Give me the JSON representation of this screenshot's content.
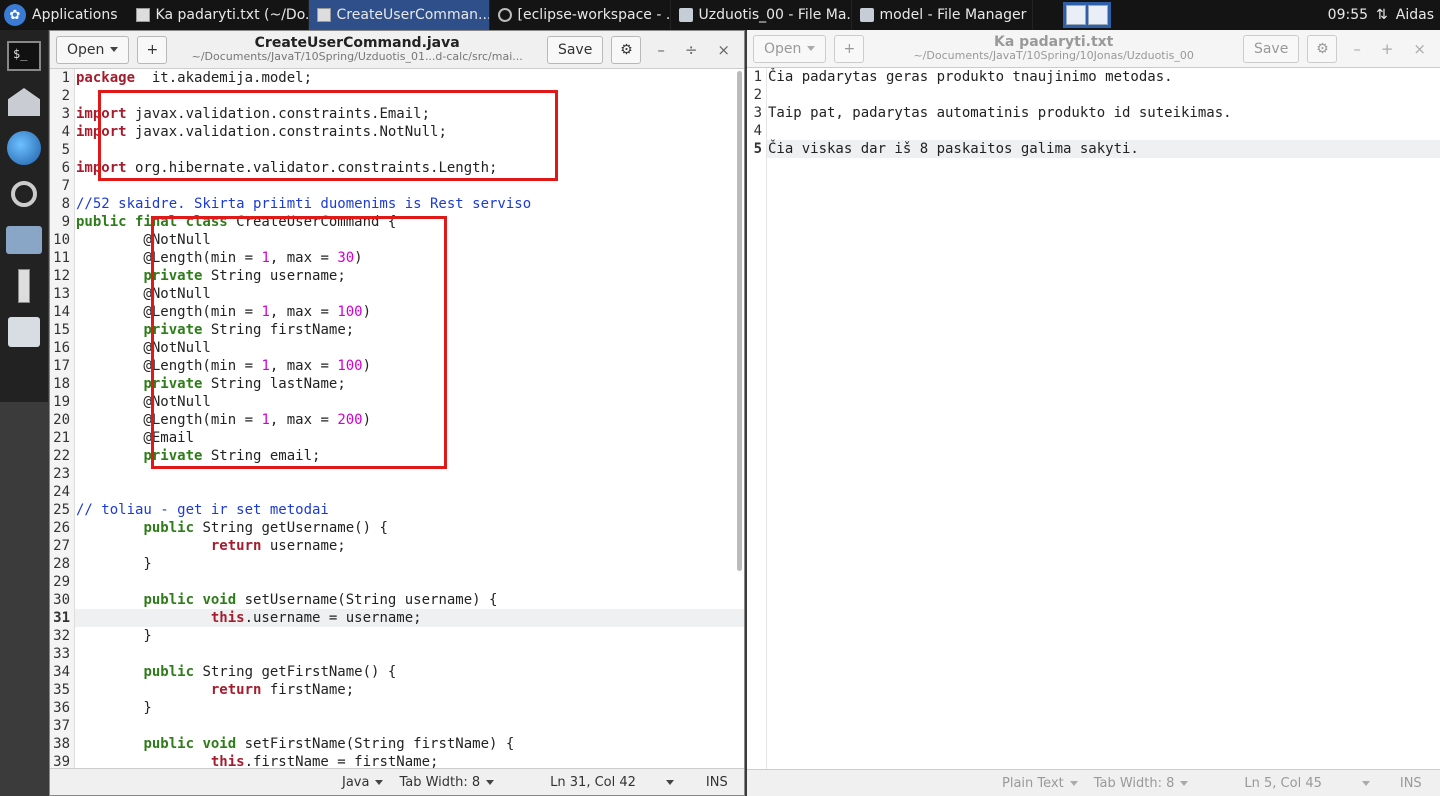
{
  "taskbar": {
    "apps_label": "Applications",
    "tasks": [
      {
        "label": "Ka padaryti.txt (~/Do...",
        "icon": "text-editor-icon"
      },
      {
        "label": "CreateUserComman...",
        "icon": "text-editor-icon"
      },
      {
        "label": "[eclipse-workspace - ...",
        "icon": "eclipse-icon"
      },
      {
        "label": "Uzduotis_00 - File Ma...",
        "icon": "folder-icon"
      },
      {
        "label": "model - File Manager",
        "icon": "folder-icon"
      }
    ],
    "clock": "09:55",
    "user": "Aidas"
  },
  "left": {
    "open_label": "Open",
    "save_label": "Save",
    "title": "CreateUserCommand.java",
    "subtitle": "~/Documents/JavaT/10Spring/Uzduotis_01...d-calc/src/mai...",
    "status": {
      "language": "Java",
      "tab_width": "Tab Width: 8",
      "position": "Ln 31, Col 42",
      "mode": "INS"
    },
    "current_line": 31,
    "lines": [
      [
        [
          "kw",
          "package"
        ],
        [
          "",
          "  it.akademija.model;"
        ]
      ],
      [],
      [
        [
          "kw",
          "import"
        ],
        [
          "",
          " javax.validation.constraints.Email;"
        ]
      ],
      [
        [
          "kw",
          "import"
        ],
        [
          "",
          " javax.validation.constraints.NotNull;"
        ]
      ],
      [],
      [
        [
          "kw",
          "import"
        ],
        [
          "",
          " org.hibernate.validator.constraints.Length;"
        ]
      ],
      [],
      [
        [
          "cmt",
          "//52 skaidre. Skirta priimti duomenims is Rest serviso"
        ]
      ],
      [
        [
          "kw2",
          "public final class"
        ],
        [
          "",
          " CreateUserCommand {"
        ]
      ],
      [
        [
          "",
          "        @NotNull"
        ]
      ],
      [
        [
          "",
          "        @Length(min = "
        ],
        [
          "num",
          "1"
        ],
        [
          "",
          ", max = "
        ],
        [
          "num",
          "30"
        ],
        [
          "",
          ")"
        ]
      ],
      [
        [
          "",
          "        "
        ],
        [
          "kw2",
          "private"
        ],
        [
          "",
          " String username;"
        ]
      ],
      [
        [
          "",
          "        @NotNull"
        ]
      ],
      [
        [
          "",
          "        @Length(min = "
        ],
        [
          "num",
          "1"
        ],
        [
          "",
          ", max = "
        ],
        [
          "num",
          "100"
        ],
        [
          "",
          ")"
        ]
      ],
      [
        [
          "",
          "        "
        ],
        [
          "kw2",
          "private"
        ],
        [
          "",
          " String firstName;"
        ]
      ],
      [
        [
          "",
          "        @NotNull"
        ]
      ],
      [
        [
          "",
          "        @Length(min = "
        ],
        [
          "num",
          "1"
        ],
        [
          "",
          ", max = "
        ],
        [
          "num",
          "100"
        ],
        [
          "",
          ")"
        ]
      ],
      [
        [
          "",
          "        "
        ],
        [
          "kw2",
          "private"
        ],
        [
          "",
          " String lastName;"
        ]
      ],
      [
        [
          "",
          "        @NotNull"
        ]
      ],
      [
        [
          "",
          "        @Length(min = "
        ],
        [
          "num",
          "1"
        ],
        [
          "",
          ", max = "
        ],
        [
          "num",
          "200"
        ],
        [
          "",
          ")"
        ]
      ],
      [
        [
          "",
          "        @Email"
        ]
      ],
      [
        [
          "",
          "        "
        ],
        [
          "kw2",
          "private"
        ],
        [
          "",
          " String email;"
        ]
      ],
      [],
      [],
      [
        [
          "cmt",
          "// toliau - get ir set metodai"
        ]
      ],
      [
        [
          "",
          "        "
        ],
        [
          "kw2",
          "public"
        ],
        [
          "",
          " String getUsername() {"
        ]
      ],
      [
        [
          "",
          "                "
        ],
        [
          "kw",
          "return"
        ],
        [
          "",
          " username;"
        ]
      ],
      [
        [
          "",
          "        }"
        ]
      ],
      [],
      [
        [
          "",
          "        "
        ],
        [
          "kw2",
          "public void"
        ],
        [
          "",
          " setUsername(String username) {"
        ]
      ],
      [
        [
          "",
          "                "
        ],
        [
          "kw",
          "this"
        ],
        [
          "",
          ".username = username;"
        ]
      ],
      [
        [
          "",
          "        }"
        ]
      ],
      [],
      [
        [
          "",
          "        "
        ],
        [
          "kw2",
          "public"
        ],
        [
          "",
          " String getFirstName() {"
        ]
      ],
      [
        [
          "",
          "                "
        ],
        [
          "kw",
          "return"
        ],
        [
          "",
          " firstName;"
        ]
      ],
      [
        [
          "",
          "        }"
        ]
      ],
      [],
      [
        [
          "",
          "        "
        ],
        [
          "kw2",
          "public void"
        ],
        [
          "",
          " setFirstName(String firstName) {"
        ]
      ],
      [
        [
          "",
          "                "
        ],
        [
          "kw",
          "this"
        ],
        [
          "",
          ".firstName = firstName;"
        ]
      ]
    ]
  },
  "right": {
    "open_label": "Open",
    "save_label": "Save",
    "title": "Ka padaryti.txt",
    "subtitle": "~/Documents/JavaT/10Spring/10Jonas/Uzduotis_00",
    "status": {
      "language": "Plain Text",
      "tab_width": "Tab Width: 8",
      "position": "Ln 5, Col 45",
      "mode": "INS"
    },
    "current_line": 5,
    "lines": [
      [
        [
          "",
          "Čia padarytas geras produkto tnaujinimo metodas."
        ]
      ],
      [],
      [
        [
          "",
          "Taip pat, padarytas automatinis produkto id suteikimas."
        ]
      ],
      [],
      [
        [
          "",
          "Čia viskas dar iš 8 paskaitos galima sakyti."
        ]
      ]
    ]
  },
  "colors": {
    "highlight_box": "#e01818",
    "keyword": "#a51d2d",
    "type_keyword": "#2e7d1a",
    "number": "#d300d3",
    "comment": "#1c3bd4"
  }
}
